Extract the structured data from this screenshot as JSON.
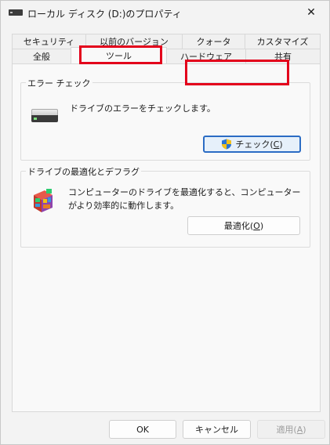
{
  "window": {
    "title": "ローカル ディスク (D:)のプロパティ",
    "close_glyph": "✕"
  },
  "tabs": {
    "row1": [
      {
        "label": "セキュリティ"
      },
      {
        "label": "以前のバージョン"
      },
      {
        "label": "クォータ"
      },
      {
        "label": "カスタマイズ"
      }
    ],
    "row2": [
      {
        "label": "全般"
      },
      {
        "label": "ツール",
        "active": true
      },
      {
        "label": "ハードウェア"
      },
      {
        "label": "共有"
      }
    ]
  },
  "error_check": {
    "title": "エラー チェック",
    "description": "ドライブのエラーをチェックします。",
    "button_label": "チェック(",
    "button_access_key": "C",
    "button_suffix": ")"
  },
  "optimize": {
    "title": "ドライブの最適化とデフラグ",
    "description": "コンピューターのドライブを最適化すると、コンピューターがより効率的に動作します。",
    "button_label": "最適化(",
    "button_access_key": "O",
    "button_suffix": ")"
  },
  "footer": {
    "ok_label": "OK",
    "cancel_label": "キャンセル",
    "apply_label": "適用(",
    "apply_access_key": "A",
    "apply_suffix": ")"
  },
  "colors": {
    "highlight": "#e3001b",
    "accent": "#2b6cc4"
  }
}
